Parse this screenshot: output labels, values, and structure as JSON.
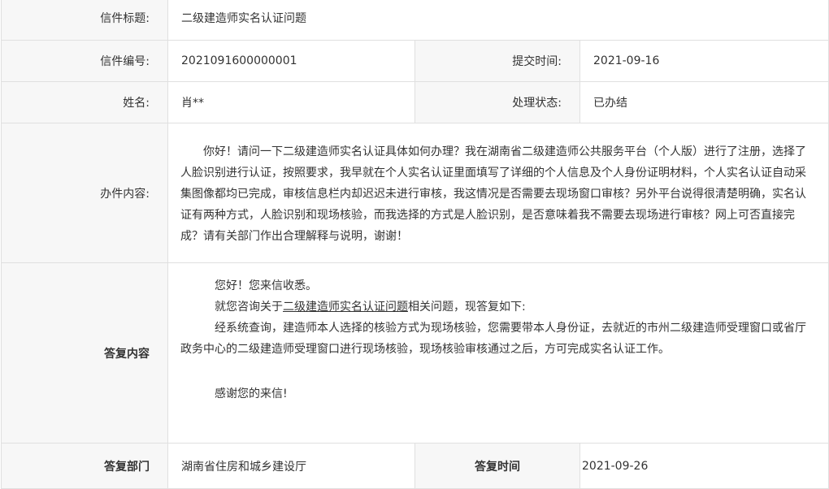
{
  "letter": {
    "title_label": "信件标题:",
    "title_value": "二级建造师实名认证问题",
    "number_label": "信件编号:",
    "number_value": "2021091600000001",
    "submit_time_label": "提交时间:",
    "submit_time_value": "2021-09-16",
    "name_label": "姓名:",
    "name_value": "肖**",
    "status_label": "处理状态:",
    "status_value": "已办结",
    "content_label": "办件内容:",
    "content_text": "你好！请问一下二级建造师实名认证具体如何办理？我在湖南省二级建造师公共服务平台（个人版）进行了注册，选择了人脸识别进行认证，按照要求，我早就在个人实名认证里面填写了详细的个人信息及个人身份证明材料，个人实名认证自动采集图像都均已完成，审核信息栏内却迟迟未进行审核，我这情况是否需要去现场窗口审核？另外平台说得很清楚明确，实名认证有两种方式，人脸识别和现场核验，而我选择的方式是人脸识别，是否意味着我不需要去现场进行审核？网上可否直接完成？请有关部门作出合理解释与说明，谢谢！"
  },
  "reply": {
    "label": "答复内容",
    "greeting": "您好！您来信收悉。",
    "intro_prefix": "就您咨询关于",
    "intro_link": "二级建造师实名认证问题",
    "intro_suffix": "相关问题，现答复如下:",
    "body_line1": "经系统查询，建造师本人选择的核验方式为现场核验，您需要带本人身份证，去就近的市州二级建造师受理窗口或省厅",
    "body_line2": "政务中心的二级建造师受理窗口进行现场核验，现场核验审核通过之后，方可完成实名认证工作。",
    "thanks": "感谢您的来信!",
    "dept_label": "答复部门",
    "dept_value": "湖南省住房和城乡建设厅",
    "time_label": "答复时间",
    "time_value": "2021-09-26"
  }
}
